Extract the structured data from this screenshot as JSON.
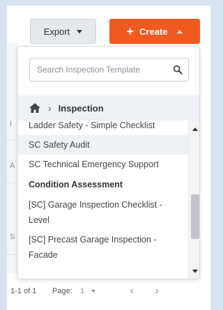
{
  "toolbar": {
    "export_label": "Export",
    "create_label": "Create"
  },
  "dropdown": {
    "search_placeholder": "Search Inspection Template",
    "breadcrumb_label": "Inspection",
    "items": [
      {
        "label": "Ladder Safety - Simple Checklist",
        "kind": "item"
      },
      {
        "label": "SC Safety Audit",
        "kind": "item"
      },
      {
        "label": "SC Technical Emergency Support",
        "kind": "item"
      },
      {
        "label": "Condition Assessment",
        "kind": "heading"
      },
      {
        "label": "[SC] Garage Inspection Checklist - Level",
        "kind": "item"
      },
      {
        "label": "[SC] Precast Garage Inspection - Facade",
        "kind": "item"
      }
    ]
  },
  "background": {
    "row_marks": [
      "I",
      "A",
      "S"
    ]
  },
  "pagination": {
    "count": "1-1 of 1",
    "page_label": "Page:",
    "page_value": "1"
  },
  "colors": {
    "create_accent": "#f05a1f",
    "backdrop": "#d7e3f1"
  }
}
